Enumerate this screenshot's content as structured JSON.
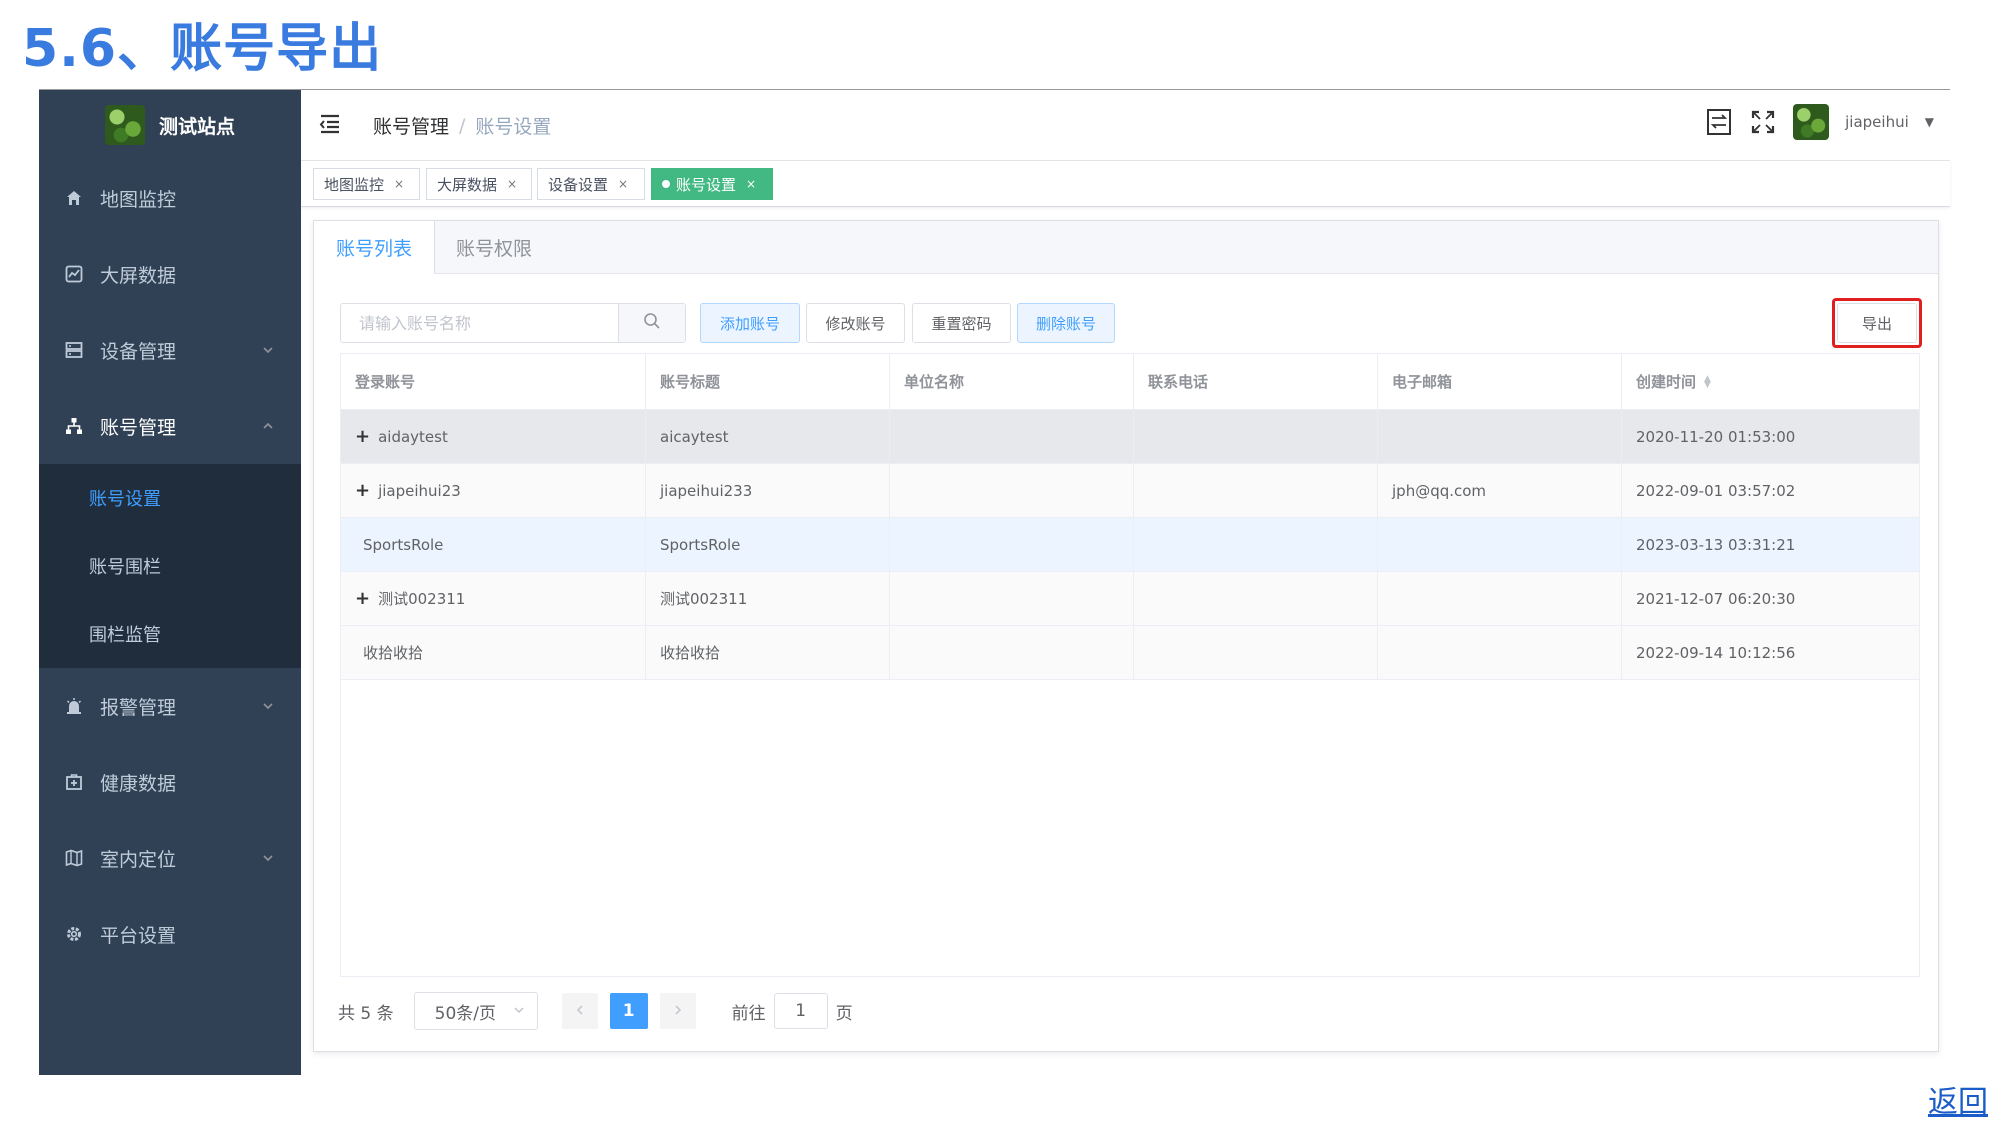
{
  "page_heading": "5.6、账号导出",
  "back_link": "返回",
  "sidebar": {
    "logo_text": "测试站点",
    "items": [
      {
        "label": "地图监控",
        "icon": "home-icon"
      },
      {
        "label": "大屏数据",
        "icon": "chart-icon"
      },
      {
        "label": "设备管理",
        "icon": "server-icon"
      },
      {
        "label": "账号管理",
        "icon": "org-tree-icon"
      },
      {
        "label": "报警管理",
        "icon": "alarm-bell-icon"
      },
      {
        "label": "健康数据",
        "icon": "medical-kit-icon"
      },
      {
        "label": "室内定位",
        "icon": "map-icon"
      },
      {
        "label": "平台设置",
        "icon": "gear-icon"
      }
    ],
    "submenu": [
      "账号设置",
      "账号围栏",
      "围栏监管"
    ]
  },
  "header": {
    "breadcrumb_main": "账号管理",
    "breadcrumb_sep": "/",
    "breadcrumb_current": "账号设置",
    "username": "jiapeihui"
  },
  "tags": [
    {
      "label": "地图监控",
      "close": "×"
    },
    {
      "label": "大屏数据",
      "close": "×"
    },
    {
      "label": "设备设置",
      "close": "×"
    },
    {
      "label": "账号设置",
      "close": "×"
    }
  ],
  "card_tabs": [
    "账号列表",
    "账号权限"
  ],
  "toolbar": {
    "search_placeholder": "请输入账号名称",
    "add": "添加账号",
    "edit": "修改账号",
    "reset": "重置密码",
    "delete": "删除账号",
    "export": "导出"
  },
  "table": {
    "columns": [
      "登录账号",
      "账号标题",
      "单位名称",
      "联系电话",
      "电子邮箱",
      "创建时间"
    ],
    "rows": [
      {
        "account": "aidaytest",
        "title": "aicaytest",
        "unit": "",
        "phone": "",
        "email": "",
        "created": "2020-11-20 01:53:00",
        "expandable": "+"
      },
      {
        "account": "jiapeihui23",
        "title": "jiapeihui233",
        "unit": "",
        "phone": "",
        "email": "jph@qq.com",
        "created": "2022-09-01 03:57:02",
        "expandable": "+"
      },
      {
        "account": "SportsRole",
        "title": "SportsRole",
        "unit": "",
        "phone": "",
        "email": "",
        "created": "2023-03-13 03:31:21",
        "expandable": ""
      },
      {
        "account": "测试002311",
        "title": "测试002311",
        "unit": "",
        "phone": "",
        "email": "",
        "created": "2021-12-07 06:20:30",
        "expandable": "+"
      },
      {
        "account": "收拾收拾",
        "title": "收拾收拾",
        "unit": "",
        "phone": "",
        "email": "",
        "created": "2022-09-14 10:12:56",
        "expandable": ""
      }
    ]
  },
  "pagination": {
    "total": "共 5 条",
    "page_size": "50条/页",
    "current_page": "1",
    "goto_label": "前往",
    "goto_value": "1",
    "page_unit": "页"
  },
  "colors": {
    "sidebar_bg": "#304156",
    "accent": "#409EFF",
    "active_tag": "#42b983",
    "highlight": "#e02020",
    "heading": "#3A7BE0"
  }
}
